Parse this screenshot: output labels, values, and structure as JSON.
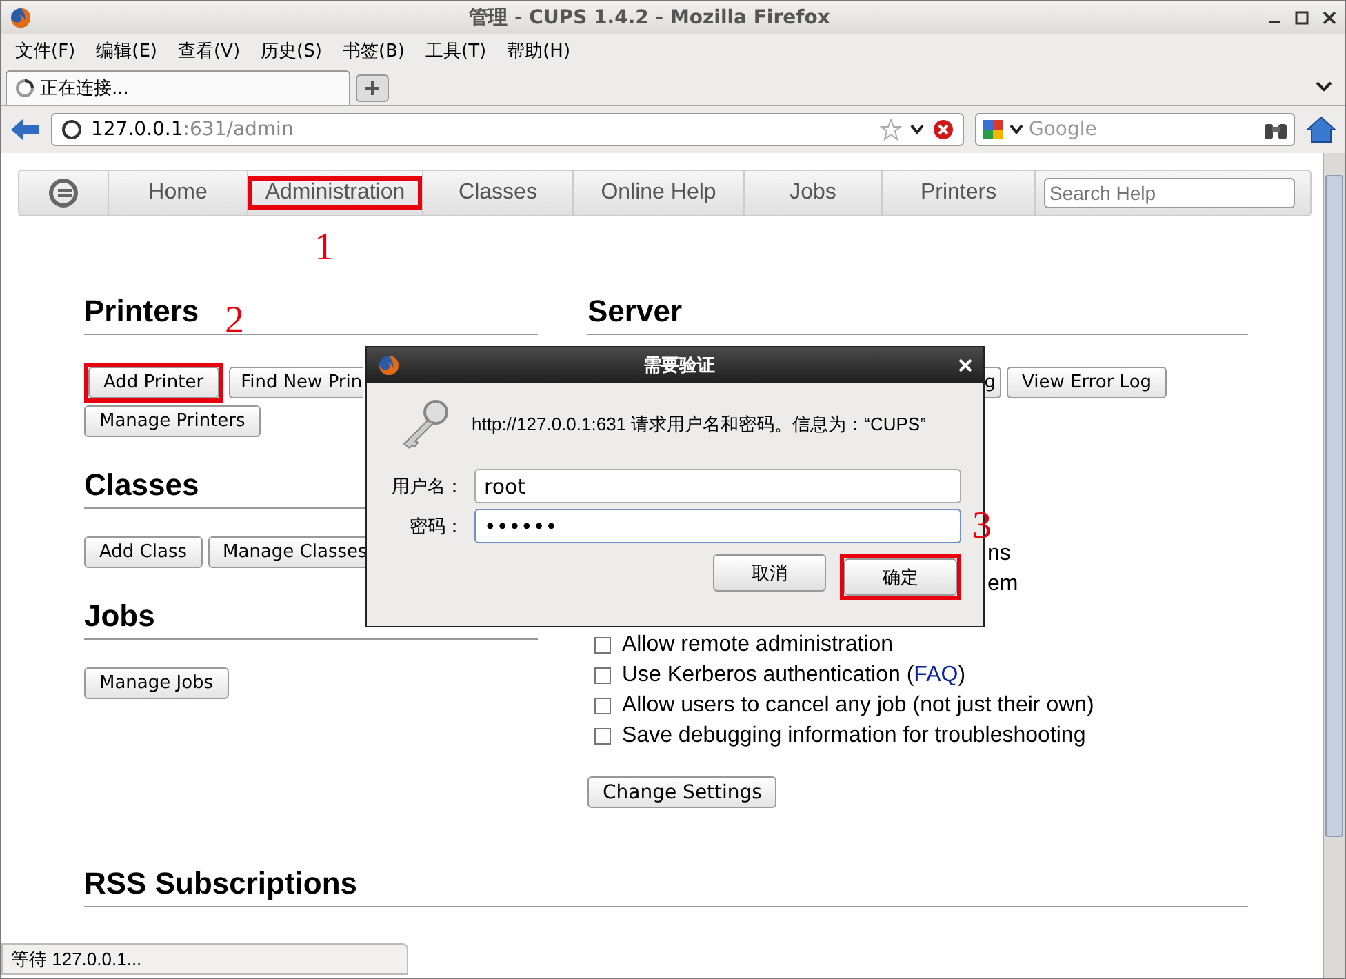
{
  "window": {
    "title": "管理 - CUPS 1.4.2 - Mozilla Firefox"
  },
  "menu": [
    "文件(F)",
    "编辑(E)",
    "查看(V)",
    "历史(S)",
    "书签(B)",
    "工具(T)",
    "帮助(H)"
  ],
  "tabs": [
    {
      "label": "正在连接...",
      "selected": true
    }
  ],
  "address": {
    "host": "127.0.0.1",
    "path": ":631/admin"
  },
  "web_search": {
    "placeholder": "Google"
  },
  "cups_nav": {
    "items": [
      {
        "label": "Home",
        "highlighted": false
      },
      {
        "label": "Administration",
        "highlighted": true,
        "annotation": "1"
      },
      {
        "label": "Classes",
        "highlighted": false
      },
      {
        "label": "Online Help",
        "highlighted": false
      },
      {
        "label": "Jobs",
        "highlighted": false
      },
      {
        "label": "Printers",
        "highlighted": false
      }
    ],
    "search_placeholder": "Search Help"
  },
  "left_sections": [
    {
      "title": "Printers",
      "annotation": "2",
      "button_rows": [
        [
          {
            "label": "Add Printer",
            "highlighted": true
          },
          {
            "label": "Find New Prin",
            "highlighted": false,
            "kind": "partial"
          }
        ],
        [
          {
            "label": "Manage Printers",
            "highlighted": false
          }
        ]
      ]
    },
    {
      "title": "Classes",
      "button_rows": [
        [
          {
            "label": "Add Class",
            "highlighted": false
          },
          {
            "label": "Manage Classes",
            "highlighted": false
          }
        ]
      ]
    },
    {
      "title": "Jobs",
      "button_rows": [
        [
          {
            "label": "Manage Jobs",
            "highlighted": false
          }
        ]
      ]
    }
  ],
  "server": {
    "title": "Server",
    "buttons": [
      {
        "label": "g",
        "kind": "partial"
      },
      {
        "label": "View Error Log",
        "kind": "button"
      }
    ],
    "options": [
      {
        "kind": "partial",
        "label": "ns"
      },
      {
        "kind": "partial",
        "label": "em"
      },
      {
        "kind": "hidden"
      },
      {
        "kind": "checkbox",
        "label": "Allow remote administration",
        "checked": false
      },
      {
        "kind": "checkbox",
        "label": "Use Kerberos authentication (",
        "link": "FAQ",
        "suffix": ")",
        "checked": false
      },
      {
        "kind": "checkbox",
        "label": "Allow users to cancel any job (not just their own)",
        "checked": false
      },
      {
        "kind": "checkbox",
        "label": "Save debugging information for troubleshooting",
        "checked": false
      }
    ],
    "submit": "Change Settings"
  },
  "rss": {
    "title": "RSS Subscriptions"
  },
  "dialog": {
    "title": "需要验证",
    "message": "http://127.0.0.1:631 请求用户名和密码。信息为：“CUPS”",
    "fields": [
      {
        "label": "用户名：",
        "value": "root",
        "focused": false
      },
      {
        "label": "密码：",
        "value": "••••••",
        "focused": true
      }
    ],
    "buttons": [
      {
        "label": "取消",
        "highlighted": false
      },
      {
        "label": "确定",
        "highlighted": true,
        "annotation": "3"
      }
    ]
  },
  "status_bar": "等待 127.0.0.1..."
}
